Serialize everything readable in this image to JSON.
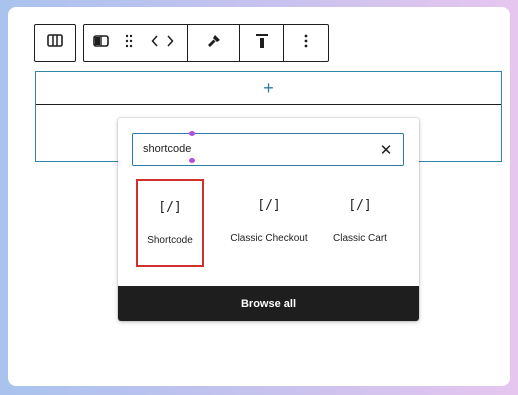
{
  "toolbar": {
    "parent_icon": "block-layout-icon",
    "block_type_icon": "columns-icon",
    "drag_icon": "drag-handle-icon",
    "move_left_icon": "chevron-left-icon",
    "move_right_icon": "chevron-right-icon",
    "style_icon": "paint-brush-icon",
    "align_icon": "align-top-icon",
    "more_icon": "more-vertical-icon"
  },
  "block": {
    "appender_label": "+"
  },
  "inserter": {
    "search_value": "shortcode",
    "clear_label": "✕",
    "results": [
      {
        "icon": "[/]",
        "label": "Shortcode",
        "selected": true
      },
      {
        "icon": "[/]",
        "label": "Classic Checkout",
        "selected": false
      },
      {
        "icon": "[/]",
        "label": "Classic Cart",
        "selected": false
      }
    ],
    "browse_all_label": "Browse all"
  },
  "colors": {
    "accent": "#2a7ea6",
    "selection_outline": "#d0312d",
    "text_caret": "#b04fe0",
    "footer_bg": "#1e1e1e"
  }
}
